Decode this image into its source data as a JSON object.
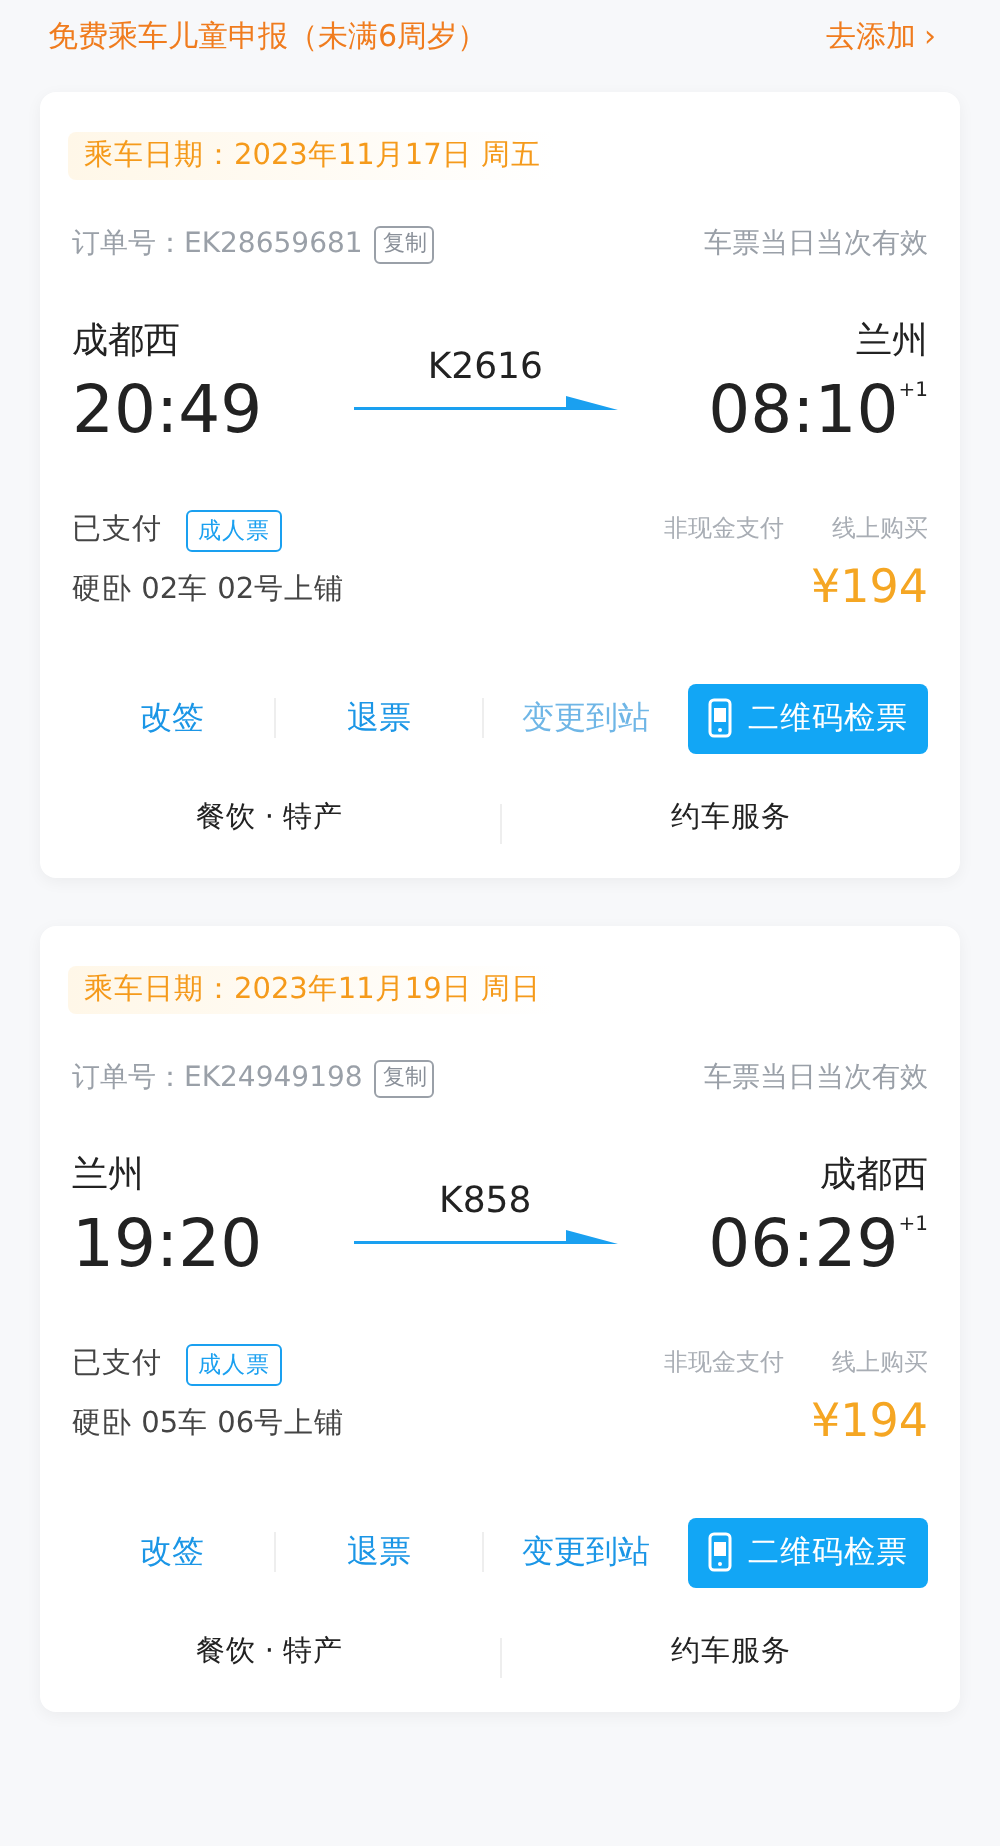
{
  "banner": {
    "text": "免费乘车儿童申报（未满6周岁）",
    "link": "去添加",
    "chevron": "›"
  },
  "tickets": [
    {
      "date": "乘车日期：2023年11月17日 周五",
      "order_label": "订单号：",
      "order_no": "EK28659681",
      "copy": "复制",
      "validity": "车票当日当次有效",
      "from_station": "成都西",
      "from_time": "20:49",
      "train": "K2616",
      "to_station": "兰州",
      "to_time": "08:10",
      "day_offset": "+1",
      "status": "已支付",
      "ticket_type": "成人票",
      "pay_method": "非现金支付",
      "channel": "线上购买",
      "seat": "硬卧 02车 02号上铺",
      "price": "¥194",
      "actions": [
        {
          "kind": "text",
          "label": "改签",
          "disabled": false
        },
        {
          "kind": "text",
          "label": "退票",
          "disabled": false
        },
        {
          "kind": "text",
          "label": "变更到站",
          "disabled": true
        },
        {
          "kind": "qr",
          "label": "二维码检票",
          "disabled": false
        }
      ],
      "services": [
        "餐饮 · 特产",
        "约车服务"
      ]
    },
    {
      "date": "乘车日期：2023年11月19日 周日",
      "order_label": "订单号：",
      "order_no": "EK24949198",
      "copy": "复制",
      "validity": "车票当日当次有效",
      "from_station": "兰州",
      "from_time": "19:20",
      "train": "K858",
      "to_station": "成都西",
      "to_time": "06:29",
      "day_offset": "+1",
      "status": "已支付",
      "ticket_type": "成人票",
      "pay_method": "非现金支付",
      "channel": "线上购买",
      "seat": "硬卧 05车 06号上铺",
      "price": "¥194",
      "actions": [
        {
          "kind": "text",
          "label": "改签",
          "disabled": false
        },
        {
          "kind": "text",
          "label": "退票",
          "disabled": false
        },
        {
          "kind": "text",
          "label": "变更到站",
          "disabled": false
        },
        {
          "kind": "qr",
          "label": "二维码检票",
          "disabled": false
        }
      ],
      "services": [
        "餐饮 · 特产",
        "约车服务"
      ]
    }
  ]
}
